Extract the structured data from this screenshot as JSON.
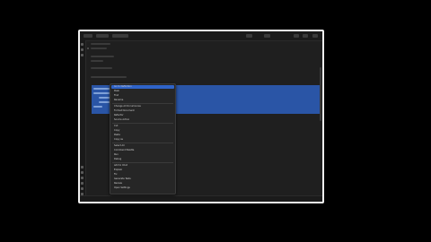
{
  "window": {
    "title": ""
  },
  "context_menu": {
    "items": [
      {
        "label": "Go to Definition",
        "shortcut": ""
      },
      {
        "label": "Peek",
        "shortcut": ""
      },
      {
        "label": "Find",
        "shortcut": ""
      },
      {
        "label": "Rename",
        "shortcut": ""
      },
      {
        "label": "Change All Occurrences",
        "shortcut": ""
      },
      {
        "label": "Format Document",
        "shortcut": ""
      },
      {
        "label": "Refactor",
        "shortcut": ""
      },
      {
        "label": "Source Action",
        "shortcut": ""
      },
      {
        "label": "Cut",
        "shortcut": ""
      },
      {
        "label": "Copy",
        "shortcut": ""
      },
      {
        "label": "Paste",
        "shortcut": ""
      },
      {
        "label": "Copy as",
        "shortcut": ""
      },
      {
        "label": "Select All",
        "shortcut": ""
      },
      {
        "label": "Command Palette",
        "shortcut": ""
      },
      {
        "label": "Run",
        "shortcut": ""
      },
      {
        "label": "Debug",
        "shortcut": ""
      },
      {
        "label": "Add to Chat",
        "shortcut": ""
      },
      {
        "label": "Explain",
        "shortcut": ""
      },
      {
        "label": "Fix",
        "shortcut": ""
      },
      {
        "label": "Generate Tests",
        "shortcut": ""
      },
      {
        "label": "Review",
        "shortcut": ""
      },
      {
        "label": "Open Settings",
        "shortcut": ""
      }
    ]
  },
  "statusbar": {
    "left": "",
    "right": ""
  }
}
